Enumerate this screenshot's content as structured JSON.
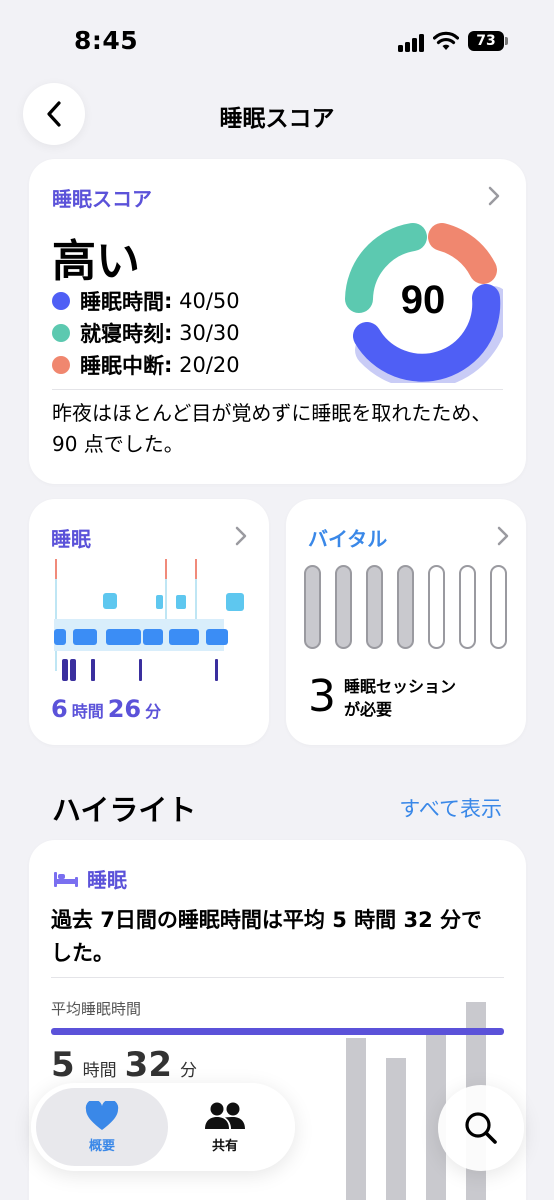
{
  "status": {
    "time": "8:45",
    "battery": "73"
  },
  "nav": {
    "title": "睡眠スコア"
  },
  "score_card": {
    "title": "睡眠スコア",
    "level": "高い",
    "score": "90",
    "components": [
      {
        "name": "睡眠時間",
        "value": "40/50",
        "color": "#4f5ff5"
      },
      {
        "name": "就寝時刻",
        "value": "30/30",
        "color": "#5cc9b0"
      },
      {
        "name": "睡眠中断",
        "value": "20/20",
        "color": "#f0876f"
      }
    ],
    "description": "昨夜はほとんど目が覚めずに睡眠を取れたため、90 点でした。"
  },
  "sleep_card": {
    "title": "睡眠",
    "hours": "6",
    "hours_unit": "時間",
    "minutes": "26",
    "minutes_unit": "分"
  },
  "vitals_card": {
    "title": "バイタル",
    "count": "3",
    "text_line1": "睡眠セッション",
    "text_line2": "が必要",
    "pills_total": 7,
    "pills_filled": 4
  },
  "highlights": {
    "heading": "ハイライト",
    "show_all": "すべて表示",
    "category": "睡眠",
    "text": "過去 7日間の睡眠時間は平均 5 時間 32 分でした。",
    "avg_label": "平均睡眠時間",
    "avg_hours": "5",
    "avg_hours_unit": "時間",
    "avg_minutes": "32",
    "avg_minutes_unit": "分"
  },
  "tabbar": {
    "tabs": [
      {
        "label": "概要",
        "icon": "heart-icon",
        "active": true
      },
      {
        "label": "共有",
        "icon": "people-icon",
        "active": false
      }
    ]
  },
  "colors": {
    "accent_purple": "#5b52d9",
    "accent_blue": "#3a88e8",
    "background": "#f2f2f6"
  }
}
